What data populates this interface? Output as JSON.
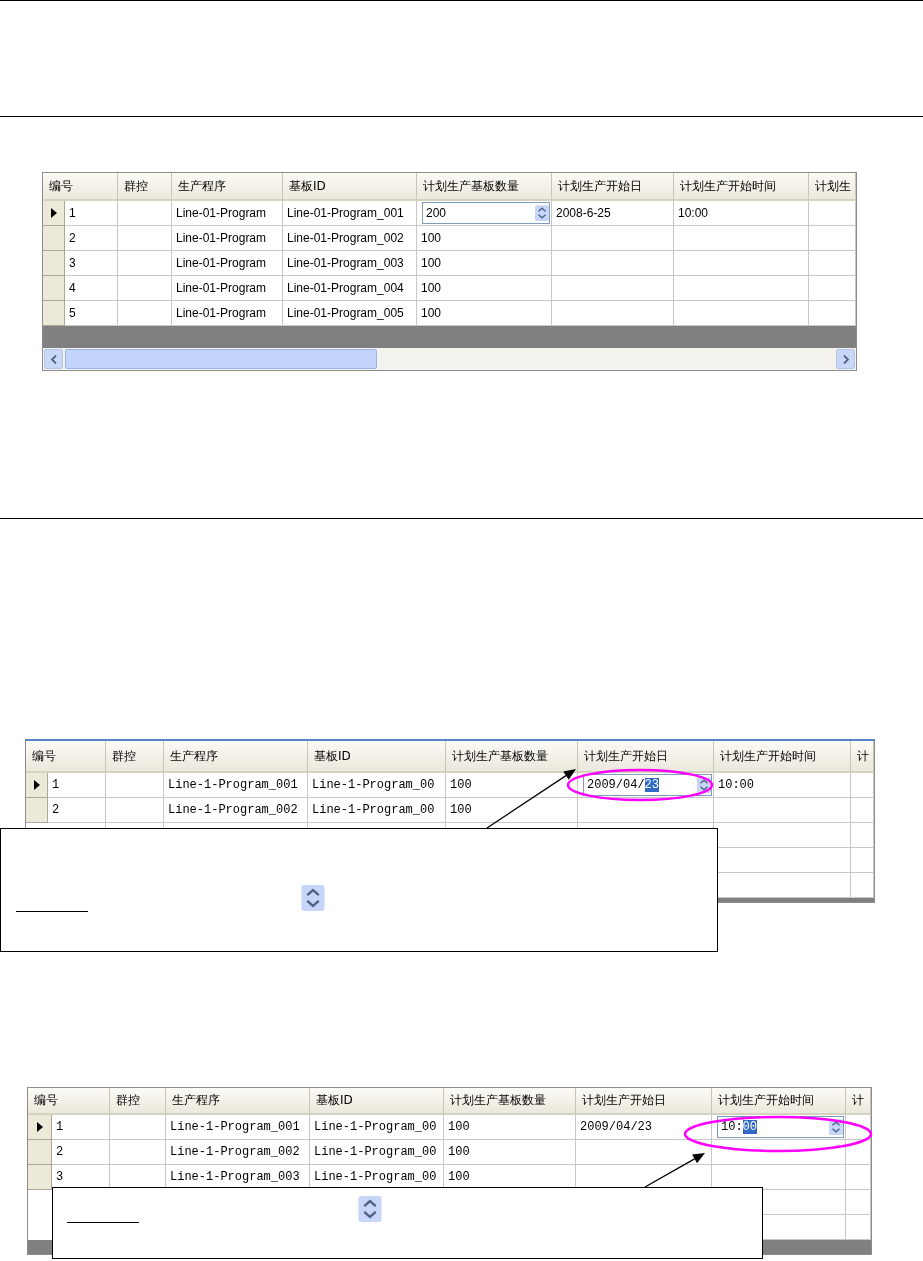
{
  "grids": [
    {
      "columns": [
        "编号",
        "群控",
        "生产程序",
        "基板ID",
        "计划生产基板数量",
        "计划生产开始日",
        "计划生产开始时间",
        "计划生"
      ],
      "rows": [
        {
          "current": true,
          "cells": [
            "1",
            null,
            "Line-01-Program",
            "Line-01-Program_001",
            {
              "kind": "spin",
              "text": "200"
            },
            "2008-6-25",
            "10:00",
            null
          ]
        },
        {
          "current": false,
          "cells": [
            "2",
            null,
            "Line-01-Program",
            "Line-01-Program_002",
            "100",
            null,
            null,
            null
          ]
        },
        {
          "current": false,
          "cells": [
            "3",
            null,
            "Line-01-Program",
            "Line-01-Program_003",
            "100",
            null,
            null,
            null
          ]
        },
        {
          "current": false,
          "cells": [
            "4",
            null,
            "Line-01-Program",
            "Line-01-Program_004",
            "100",
            null,
            null,
            null
          ]
        },
        {
          "current": false,
          "cells": [
            "5",
            null,
            "Line-01-Program",
            "Line-01-Program_005",
            "100",
            null,
            null,
            null
          ]
        }
      ]
    },
    {
      "columns": [
        "编号",
        "群控",
        "生产程序",
        "基板ID",
        "计划生产基板数量",
        "计划生产开始日",
        "计划生产开始时间",
        "计"
      ],
      "rows": [
        {
          "current": true,
          "cells": [
            "1",
            null,
            "Line-1-Program_001",
            "Line-1-Program_00",
            "100",
            {
              "kind": "spin",
              "text": "2009/04/",
              "highlight": "23"
            },
            "10:00",
            null
          ]
        },
        {
          "current": false,
          "cells": [
            "2",
            null,
            "Line-1-Program_002",
            "Line-1-Program_00",
            "100",
            null,
            null,
            null
          ]
        }
      ]
    },
    {
      "columns": [
        "编号",
        "群控",
        "生产程序",
        "基板ID",
        "计划生产基板数量",
        "计划生产开始日",
        "计划生产开始时间",
        "计"
      ],
      "rows": [
        {
          "current": true,
          "cells": [
            "1",
            null,
            "Line-1-Program_001",
            "Line-1-Program_00",
            "100",
            "2009/04/23",
            {
              "kind": "spin",
              "text": "10:",
              "highlight": "00"
            },
            null
          ]
        },
        {
          "current": false,
          "cells": [
            "2",
            null,
            "Line-1-Program_002",
            "Line-1-Program_00",
            "100",
            null,
            null,
            null
          ]
        },
        {
          "current": false,
          "cells": [
            "3",
            null,
            "Line-1-Program_003",
            "Line-1-Program_00",
            "100",
            null,
            null,
            null
          ]
        }
      ]
    }
  ]
}
